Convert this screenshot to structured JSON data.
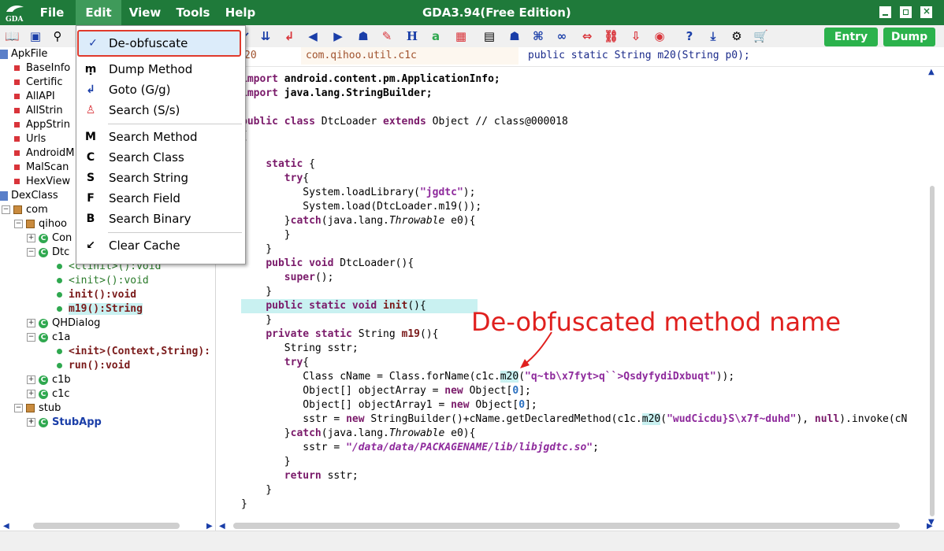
{
  "titlebar": {
    "logo_text": "GDA",
    "window_title": "GDA3.94(Free Edition)",
    "menu": [
      "File",
      "Edit",
      "View",
      "Tools",
      "Help"
    ]
  },
  "toolbar": {
    "entry_label": "Entry",
    "dump_label": "Dump"
  },
  "tree": [
    {
      "label": "ApkFile",
      "type": "root"
    },
    {
      "label": "BaseInfo",
      "type": "leaf"
    },
    {
      "label": "Certific",
      "type": "leaf"
    },
    {
      "label": "AllAPI",
      "type": "leaf"
    },
    {
      "label": "AllStrin",
      "type": "leaf"
    },
    {
      "label": "AppStrin",
      "type": "leaf"
    },
    {
      "label": "Urls",
      "type": "leaf"
    },
    {
      "label": "AndroidM",
      "type": "leaf"
    },
    {
      "label": "MalScan",
      "type": "leaf"
    },
    {
      "label": "HexView",
      "type": "leaf"
    },
    {
      "label": "DexClass",
      "type": "root"
    },
    {
      "label": "com",
      "type": "pkg"
    },
    {
      "label": "qihoo",
      "type": "pkg"
    },
    {
      "label": "Con",
      "type": "class"
    },
    {
      "label": "Dtc",
      "type": "class"
    },
    {
      "label": "<clinit>():void",
      "type": "method"
    },
    {
      "label": "<init>():void",
      "type": "method"
    },
    {
      "label": "init():void",
      "type": "method"
    },
    {
      "label": "m19():String",
      "type": "method"
    },
    {
      "label": "QHDialog",
      "type": "class"
    },
    {
      "label": "c1a",
      "type": "class"
    },
    {
      "label": "<init>(Context,String):",
      "type": "method"
    },
    {
      "label": "run():void",
      "type": "method"
    },
    {
      "label": "c1b",
      "type": "class"
    },
    {
      "label": "c1c",
      "type": "class"
    },
    {
      "label": "stub",
      "type": "pkg"
    },
    {
      "label": "StubApp",
      "type": "class"
    }
  ],
  "editor": {
    "header": [
      "20",
      "com.qihoo.util.c1c",
      "public static String m20(String p0);"
    ]
  },
  "code": [
    "import android.content.pm.ApplicationInfo;",
    "import java.lang.StringBuilder;",
    "",
    "public class DtcLoader extends Object // class@000018",
    "{",
    "",
    "    static {",
    "       try{",
    "          System.loadLibrary(\"jgdtc\");",
    "          System.load(DtcLoader.m19());",
    "       }catch(java.lang.Throwable e0){",
    "       }",
    "    }",
    "    public void DtcLoader(){",
    "       super();",
    "    }",
    "    public static void init(){",
    "    }",
    "    private static String m19(){",
    "       String sstr;",
    "       try{",
    "          Class cName = Class.forName(c1c.m20(\"q~tb\\x7fyt>q``>QsdyfydiDxbuqt\"));",
    "          Object[] objectArray = new Object[0];",
    "          Object[] objectArray1 = new Object[0];",
    "          sstr = new StringBuilder()+cName.getDeclaredMethod(c1c.m20(\"wudCicdu}S\\x7f~duhd\"), null).invoke(cN",
    "       }catch(java.lang.Throwable e0){",
    "          sstr = \"/data/data/PACKAGENAME/lib/libjgdtc.so\";",
    "       }",
    "       return sstr;",
    "    }",
    "}"
  ],
  "edit_menu": [
    {
      "label": "De-obfuscate",
      "icon": "check-icon"
    },
    {
      "label": "Dump Method",
      "icon": "dump-method-icon"
    },
    {
      "label": "Goto (G/g)",
      "icon": "goto-icon"
    },
    {
      "label": "Search (S/s)",
      "icon": "search-icon"
    },
    {
      "label": "Search Method",
      "icon": "m-icon"
    },
    {
      "label": "Search Class",
      "icon": "c-icon"
    },
    {
      "label": "Search String",
      "icon": "s-icon"
    },
    {
      "label": "Search Field",
      "icon": "f-icon"
    },
    {
      "label": "Search Binary",
      "icon": "b-icon"
    },
    {
      "label": "Clear Cache",
      "icon": "broom-icon"
    }
  ],
  "annotation": "De-obfuscated method name",
  "colors": {
    "titlebar": "#1f7a3a",
    "button": "#2bb24c",
    "highlight": "#e03a2c"
  }
}
